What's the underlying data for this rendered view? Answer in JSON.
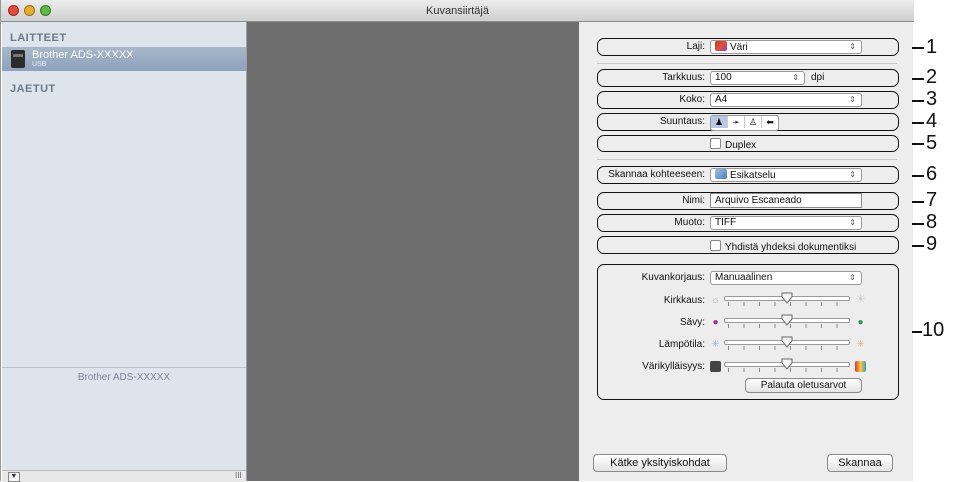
{
  "window": {
    "title": "Kuvansiirtäjä"
  },
  "sidebar": {
    "devices_header": "LAITTEET",
    "device_name": "Brother ADS-XXXXX",
    "device_connection": "USB",
    "shared_header": "JAETUT",
    "selected_device_label": "Brother ADS-XXXXX",
    "footer_button_icon": "▼",
    "footer_grip": "III"
  },
  "settings": {
    "kind_label": "Laji:",
    "kind_value": "Väri",
    "resolution_label": "Tarkkuus:",
    "resolution_value": "100",
    "resolution_unit": "dpi",
    "size_label": "Koko:",
    "size_value": "A4",
    "orientation_label": "Suuntaus:",
    "duplex_label": "Duplex",
    "destination_label": "Skannaa kohteeseen:",
    "destination_value": "Esikatselu",
    "name_label": "Nimi:",
    "name_value": "Arquivo Escaneado",
    "format_label": "Muoto:",
    "format_value": "TIFF",
    "combine_label": "Yhdistä yhdeksi dokumentiksi",
    "correction_label": "Kuvankorjaus:",
    "correction_value": "Manuaalinen",
    "brightness_label": "Kirkkaus:",
    "brightness_level": 0.5,
    "tint_label": "Sävy:",
    "tint_level": 0.5,
    "temperature_label": "Lämpötila:",
    "temperature_level": 0.5,
    "saturation_label": "Värikylläisyys:",
    "saturation_level": 0.5,
    "reset_button": "Palauta oletusarvot",
    "hide_details_button": "Kätke yksityiskohdat",
    "scan_button": "Skannaa"
  },
  "callouts": [
    "1",
    "2",
    "3",
    "4",
    "5",
    "6",
    "7",
    "8",
    "9",
    "10"
  ],
  "colors": {
    "accent_selection": "#8ea2bb",
    "preview_bg": "#6e6e6e"
  }
}
